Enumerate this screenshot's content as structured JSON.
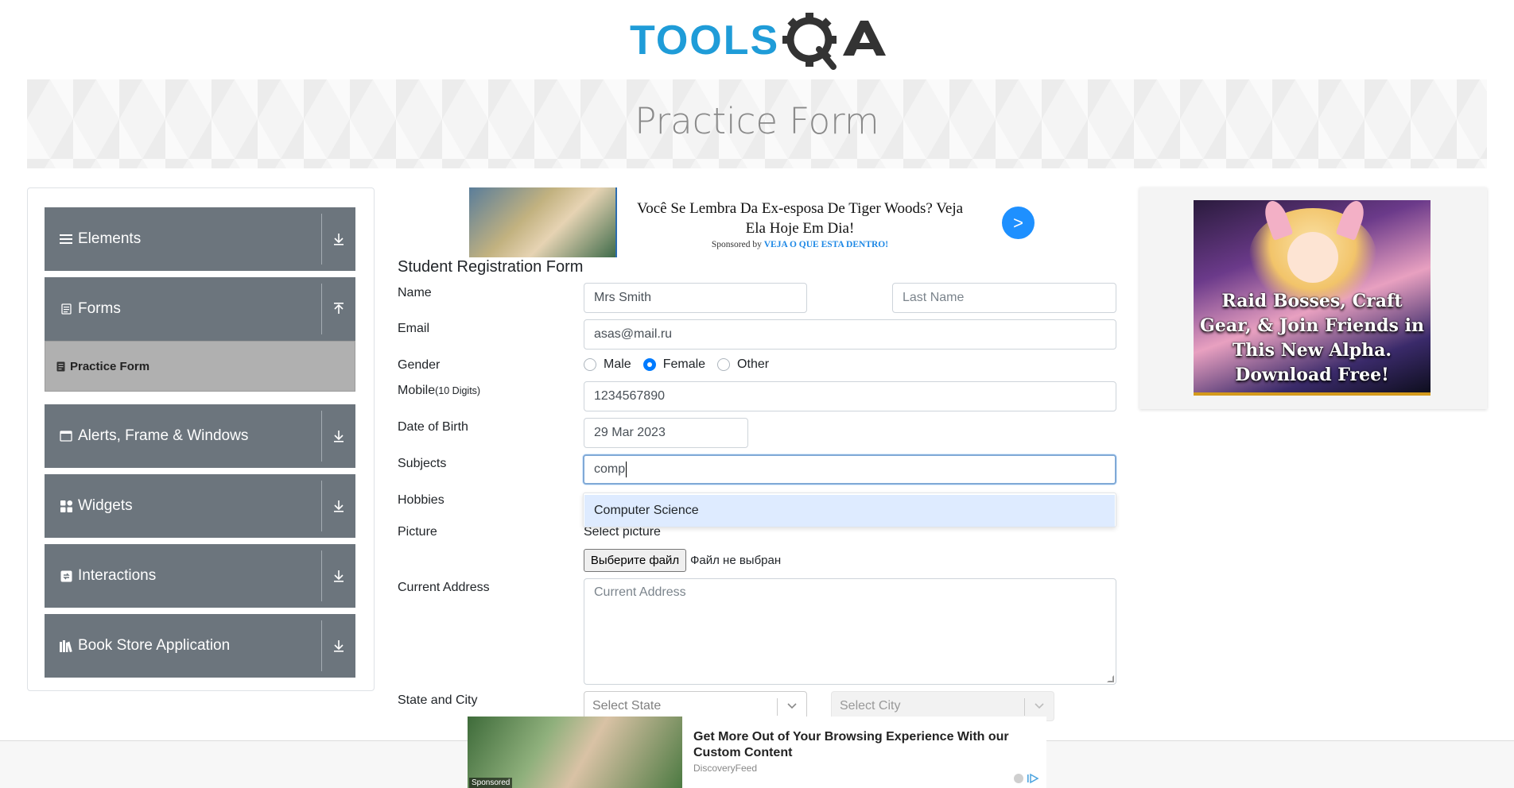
{
  "brand": {
    "logo_text": "TOOLSQA"
  },
  "banner": {
    "title": "Practice Form"
  },
  "sidebar": {
    "groups": [
      {
        "label": "Elements",
        "icon": "list-icon",
        "arrow": "download-arrow-icon"
      },
      {
        "label": "Forms",
        "icon": "form-icon",
        "arrow": "upload-arrow-icon"
      },
      {
        "label": "Alerts, Frame & Windows",
        "icon": "window-icon",
        "arrow": "download-arrow-icon"
      },
      {
        "label": "Widgets",
        "icon": "grid-icon",
        "arrow": "download-arrow-icon"
      },
      {
        "label": "Interactions",
        "icon": "interaction-icon",
        "arrow": "download-arrow-icon"
      },
      {
        "label": "Book Store Application",
        "icon": "books-icon",
        "arrow": "download-arrow-icon"
      }
    ],
    "active_subitem": "Practice Form"
  },
  "ad_top": {
    "headline": "Você Se Lembra Da Ex-esposa De Tiger Woods? Veja Ela Hoje Em Dia!",
    "sponsored_prefix": "Sponsored by",
    "sponsor": "VEJA O QUE ESTA DENTRO!",
    "button": ">"
  },
  "form": {
    "title": "Student Registration Form",
    "labels": {
      "name": "Name",
      "email": "Email",
      "gender": "Gender",
      "mobile": "Mobile",
      "mobile_hint": "(10 Digits)",
      "dob": "Date of Birth",
      "subjects": "Subjects",
      "hobbies": "Hobbies",
      "picture": "Picture",
      "address": "Current Address",
      "state_city": "State and City"
    },
    "first_name": {
      "value": "Mrs Smith"
    },
    "last_name": {
      "placeholder": "Last Name"
    },
    "email": {
      "value": "asas@mail.ru"
    },
    "gender": {
      "options": [
        "Male",
        "Female",
        "Other"
      ],
      "selected": "Female"
    },
    "mobile": {
      "value": "1234567890"
    },
    "dob": {
      "value": "29 Mar 2023"
    },
    "subjects": {
      "value": "comp",
      "suggestion": "Computer Science"
    },
    "picture": {
      "select_label": "Select picture",
      "button": "Выберите файл",
      "status": "Файл не выбран"
    },
    "address": {
      "placeholder": "Current Address"
    },
    "state": {
      "placeholder": "Select State"
    },
    "city": {
      "placeholder": "Select City"
    }
  },
  "ad_bottom": {
    "badge": "Sponsored",
    "headline": "Get More Out of Your Browsing Experience With our Custom Content",
    "brand": "DiscoveryFeed"
  },
  "ad_right": {
    "text": "Raid Bosses, Craft Gear, & Join Friends in This New Alpha. Download Free!"
  },
  "colors": {
    "brand_blue": "#1f9cd8",
    "brand_dark": "#333333",
    "sidebar_group": "#6c757d",
    "sidebar_active": "#b0b0b0",
    "radio_checked": "#007bff",
    "suggestion_bg": "#deebff"
  }
}
